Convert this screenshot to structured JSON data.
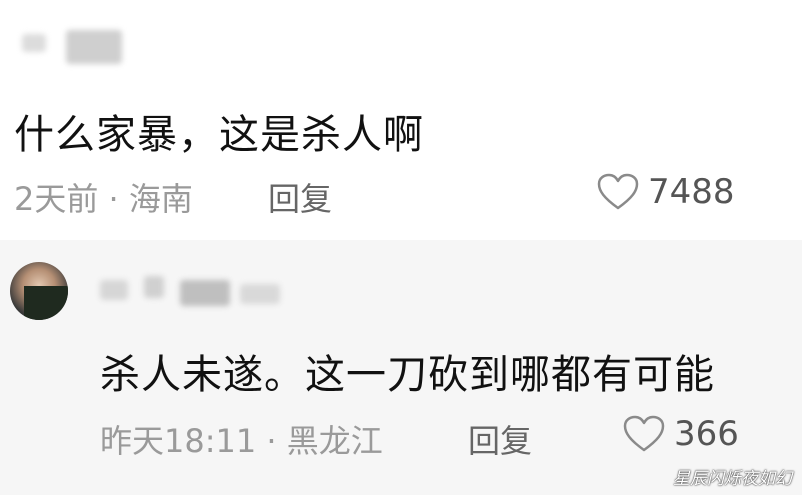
{
  "comments": [
    {
      "text": "什么家暴，这是杀人啊",
      "time": "2天前",
      "separator": "·",
      "location": "海南",
      "reply_label": "回复",
      "likes": "7488"
    },
    {
      "text": "杀人未遂。这一刀砍到哪都有可能",
      "time": "昨天18:11",
      "separator": "·",
      "location": "黑龙江",
      "reply_label": "回复",
      "likes": "366"
    }
  ],
  "watermark": "星辰闪烁夜如幻",
  "icons": {
    "like": "heart-icon",
    "avatar": "user-avatar"
  },
  "colors": {
    "meta": "#9a9a9a",
    "reply": "#666666",
    "like_count": "#555555",
    "reply_bg": "#f6f6f6"
  }
}
